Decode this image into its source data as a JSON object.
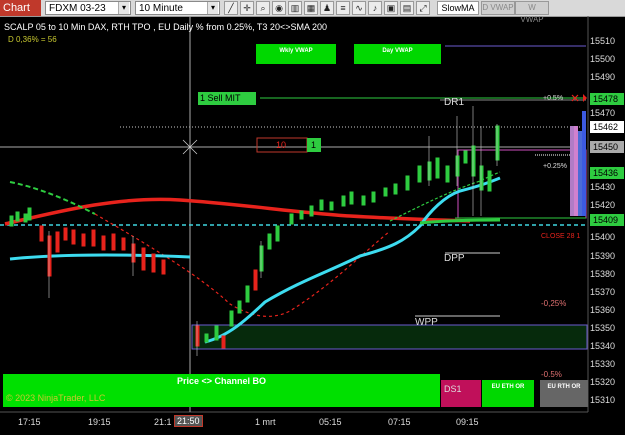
{
  "toolbar": {
    "chart_tab": "Chart",
    "instrument": "FDXM 03-23",
    "interval": "10 Minute",
    "slow_ma": "SlowMA",
    "d_vwap": "D VWAP",
    "w_vwap": "W VWAP"
  },
  "chart": {
    "title": "SCALP 05 to 10 Min DAX, RTH TPO , EU Daily % from 0.25%, T3 20<>SMA 200",
    "indicator_value": "D 0,36% = 56",
    "copyright": "© 2023 NinjaTrader, LLC",
    "wkly_vwap_button": "Wkly VWAP",
    "day_vwap_button": "Day VWAP",
    "sell_order_label": "1  Sell MIT",
    "order_qty": "10",
    "order_qty_small": "1",
    "levels": {
      "dr1": "DR1",
      "dpp": "DPP",
      "wpp": "WPP",
      "ds1": "DS1",
      "close": "CLOSE 28 1",
      "plus_05": "+0.5%",
      "plus_025": "+0.25%",
      "minus_025": "-0,25%",
      "minus_05": "-0.5%"
    },
    "channel_label": "Price <> Channel BO",
    "eu_eth_or": "EU ETH OR",
    "eu_rth_or": "EU RTH OR",
    "tags": {
      "t15478": "15478",
      "t15462": "15462",
      "t15450": "15450",
      "t15436": "15436",
      "t15409": "15409"
    },
    "price_axis": [
      "15510",
      "15500",
      "15490",
      "15480",
      "15470",
      "15460",
      "15440",
      "15430",
      "15420",
      "15410",
      "15400",
      "15390",
      "15380",
      "15370",
      "15360",
      "15350",
      "15340",
      "15330",
      "15320",
      "15310"
    ],
    "time_axis": [
      "17:15",
      "19:15",
      "21:1",
      "21:50",
      "1 mrt",
      "05:15",
      "07:15",
      "09:15"
    ]
  },
  "colors": {
    "background": "#000000",
    "sma200": "#e8231c",
    "t3": "#3ddcf0",
    "green_level": "#2ecc40",
    "cyan_dashed": "#3fd6e0",
    "green_box": "#00e000"
  }
}
